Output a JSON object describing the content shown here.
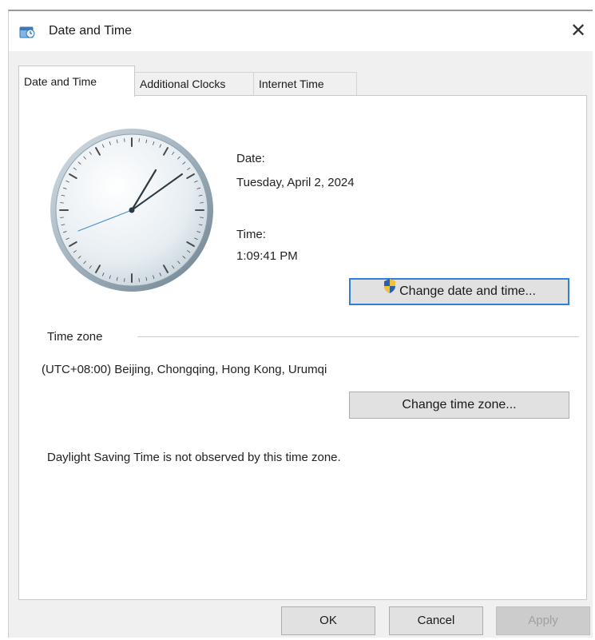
{
  "window": {
    "title": "Date and Time",
    "close_glyph": "✕"
  },
  "tabs": [
    {
      "label": "Date and Time",
      "active": true
    },
    {
      "label": "Additional Clocks",
      "active": false
    },
    {
      "label": "Internet Time",
      "active": false
    }
  ],
  "date_time": {
    "date_label": "Date:",
    "date_value": "Tuesday, April 2, 2024",
    "time_label": "Time:",
    "time_value": "1:09:41 PM",
    "change_button": "Change date and time..."
  },
  "time_zone": {
    "group_label": "Time zone",
    "value": "(UTC+08:00) Beijing, Chongqing, Hong Kong, Urumqi",
    "change_button": "Change time zone...",
    "dst_note": "Daylight Saving Time is not observed by this time zone."
  },
  "footer": {
    "ok": "OK",
    "cancel": "Cancel",
    "apply": "Apply"
  },
  "icons": {
    "title": "date-time-icon",
    "shield": "uac-shield-icon",
    "clock": "analog-clock-icon"
  },
  "colors": {
    "accent": "#2f7fd6",
    "window_bg": "#f0f0f0",
    "panel_bg": "#ffffff"
  }
}
